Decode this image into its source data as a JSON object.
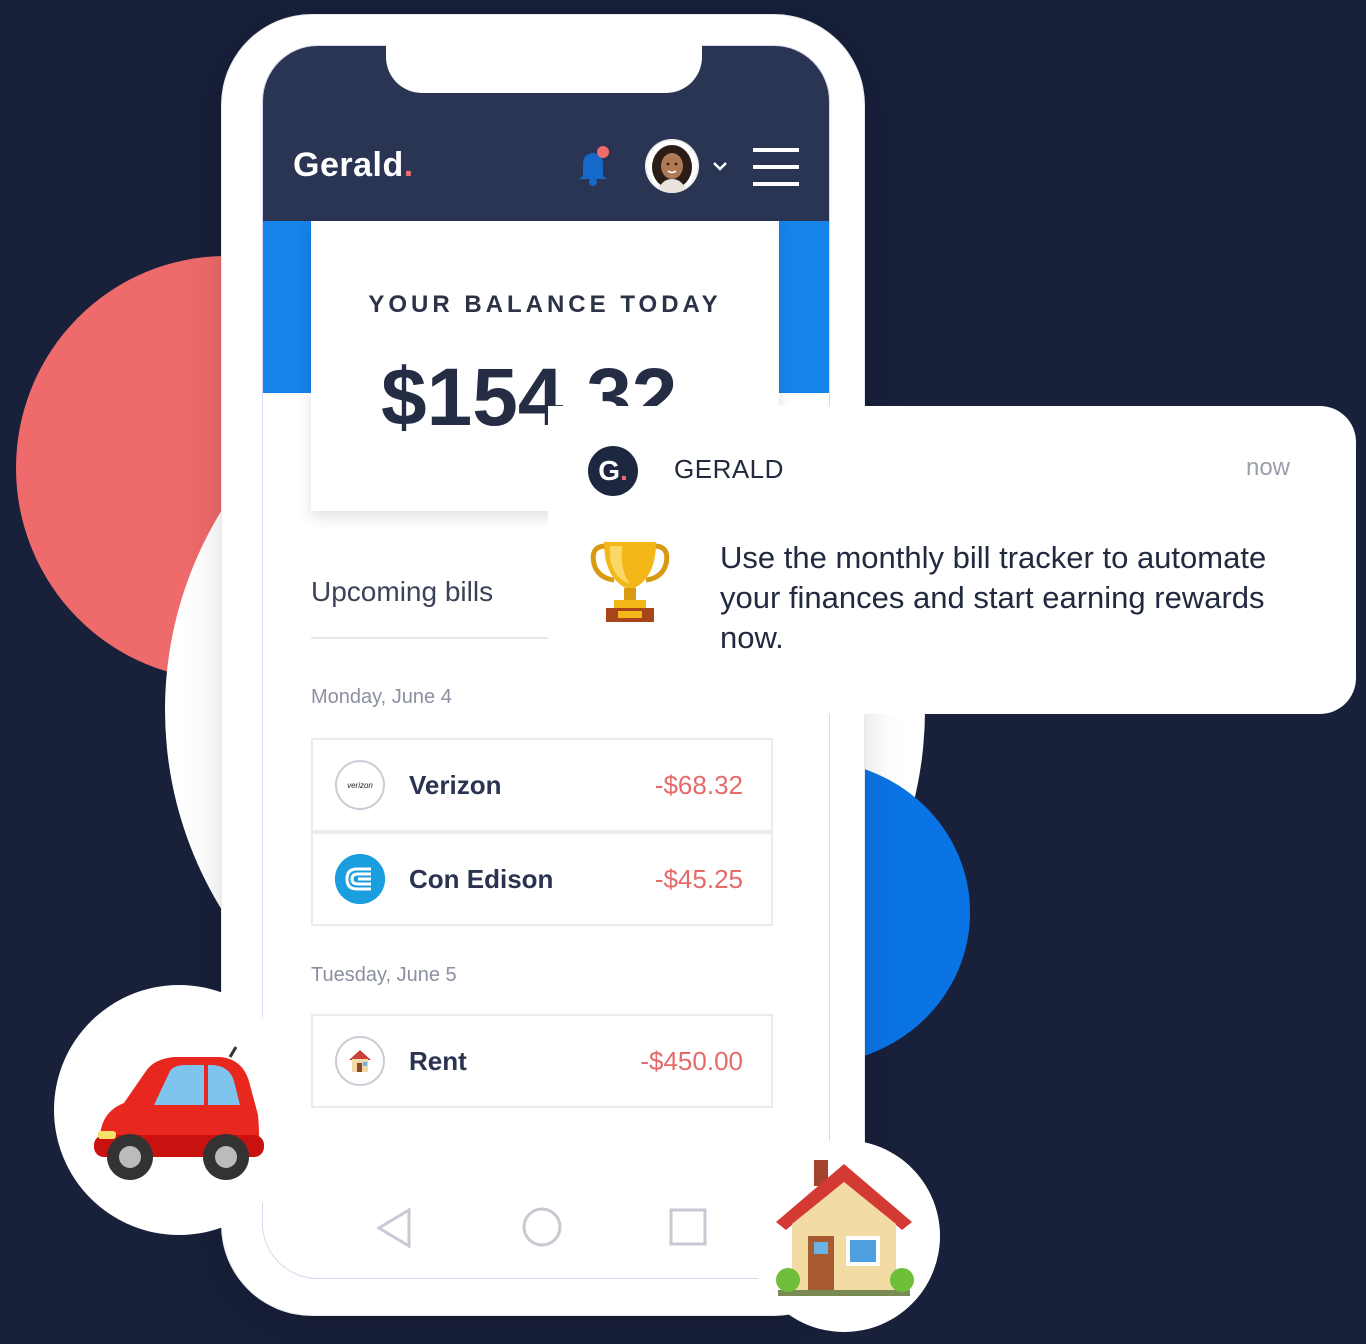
{
  "app": {
    "brand": "Gerald",
    "brand_dot": "."
  },
  "balance": {
    "label": "YOUR BALANCE TODAY",
    "amount": "$154.32"
  },
  "bills": {
    "section_title": "Upcoming bills",
    "groups": [
      {
        "date": "Monday, June 4",
        "items": [
          {
            "name": "Verizon",
            "amount": "-$68.32",
            "logo": "verizon-logo-icon",
            "logo_text": "verizon"
          },
          {
            "name": "Con Edison",
            "amount": "-$45.25",
            "logo": "con-edison-logo-icon"
          }
        ]
      },
      {
        "date": "Tuesday, June 5",
        "items": [
          {
            "name": "Rent",
            "amount": "-$450.00",
            "logo": "house-icon"
          }
        ]
      }
    ]
  },
  "notification": {
    "logo_letter": "G",
    "logo_dot": ".",
    "title": "GERALD",
    "time": "now",
    "icon": "trophy-icon",
    "message": "Use the monthly bill tracker to automate your finances and start earning rewards now."
  },
  "colors": {
    "background": "#18203a",
    "appbar": "#2a3553",
    "accent_blue": "#1683ea",
    "accent_red": "#ef6a6a",
    "amount_red": "#e56a6a"
  }
}
